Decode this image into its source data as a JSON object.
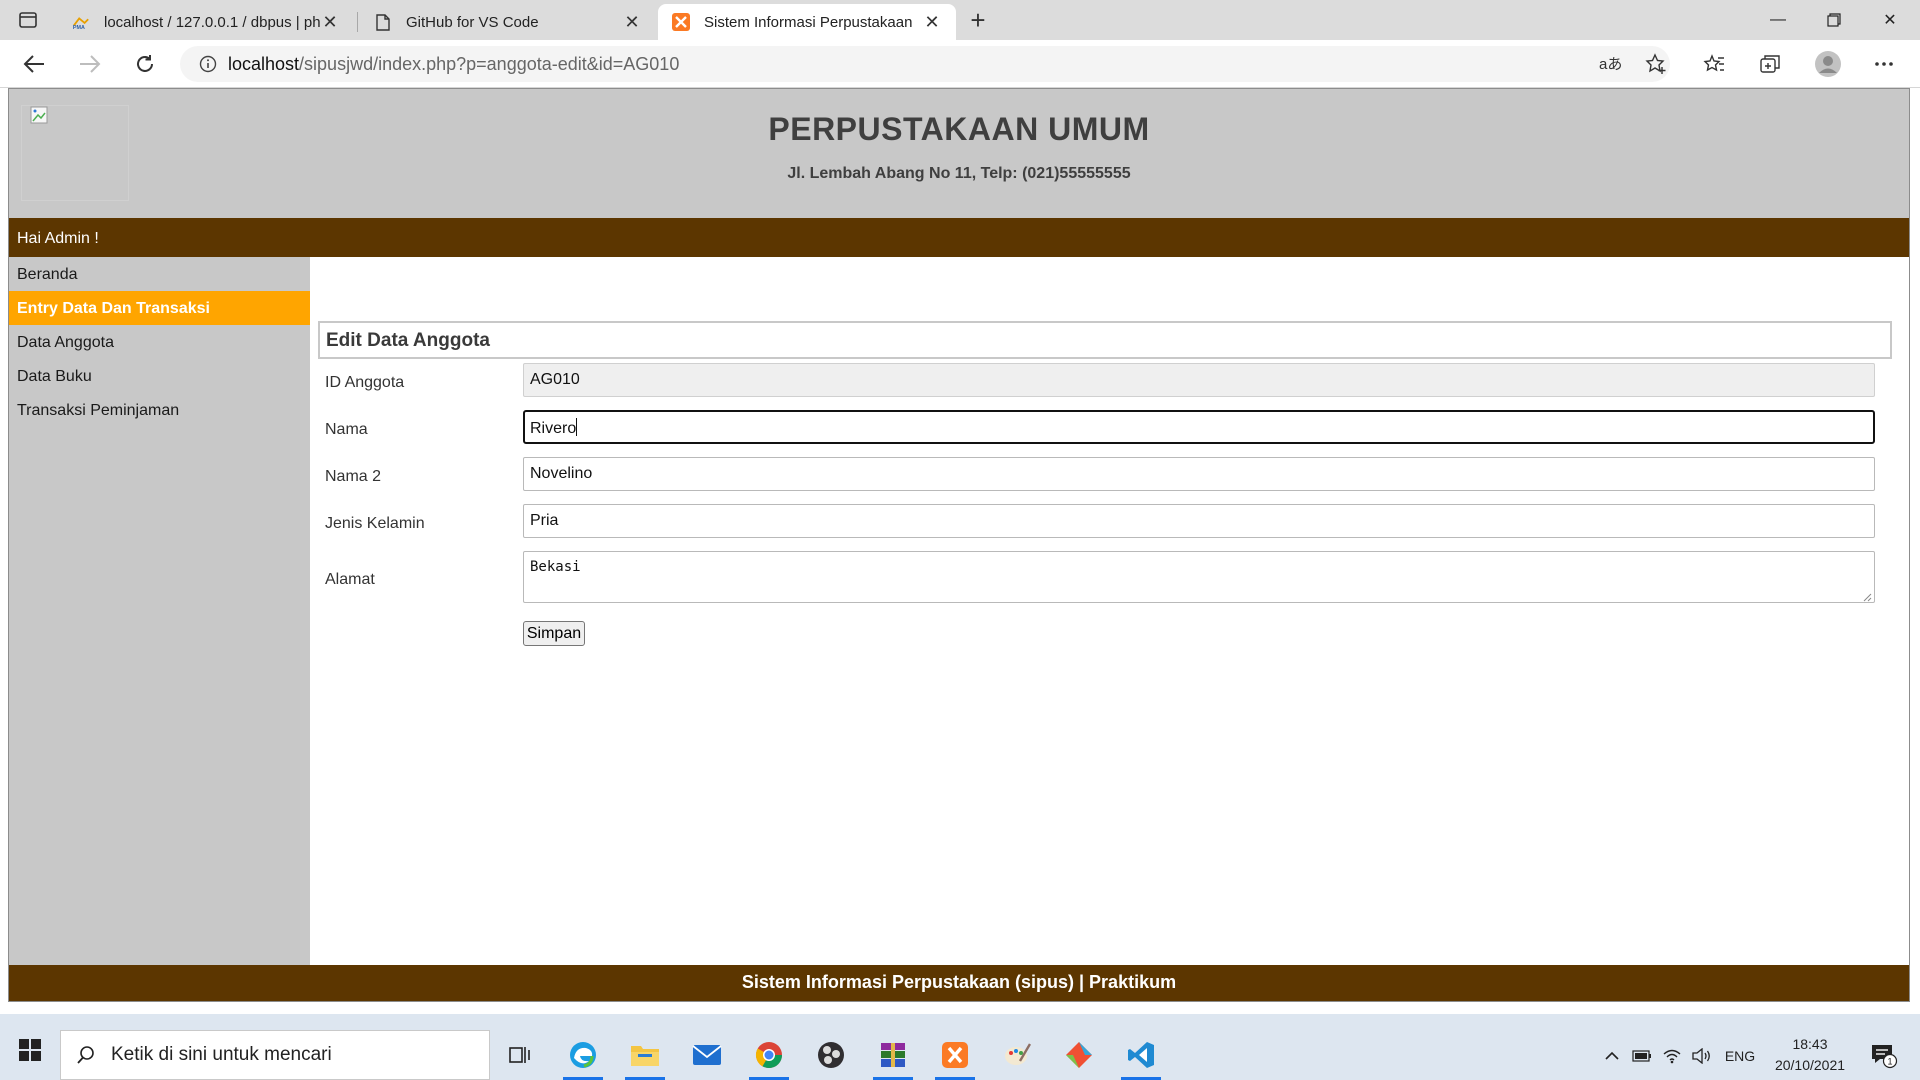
{
  "browser": {
    "tabs": [
      {
        "title": "localhost / 127.0.0.1 / dbpus | ph",
        "favicon": "phpmyadmin-icon"
      },
      {
        "title": "GitHub for VS Code",
        "favicon": "document-icon"
      },
      {
        "title": "Sistem Informasi Perpustakaan",
        "favicon": "xampp-icon",
        "active": true
      }
    ],
    "url_host": "localhost",
    "url_path": "/sipusjwd/index.php?p=anggota-edit&id=AG010"
  },
  "site": {
    "title": "PERPUSTAKAAN UMUM",
    "address": "Jl. Lembah Abang No 11, Telp: (021)55555555",
    "greeting": "Hai Admin !",
    "menu": [
      {
        "label": "Beranda",
        "active": false
      },
      {
        "label": "Entry Data Dan Transaksi",
        "active": true
      },
      {
        "label": "Data Anggota",
        "active": false
      },
      {
        "label": "Data Buku",
        "active": false
      },
      {
        "label": "Transaksi Peminjaman",
        "active": false
      }
    ],
    "footer": "Sistem Informasi Perpustakaan (sipus) | Praktikum",
    "colors": {
      "header_bg": "#c8c8c8",
      "bar_bg": "#5c3600",
      "menu_active": "#ffa500"
    }
  },
  "form": {
    "heading": "Edit Data Anggota",
    "fields": [
      {
        "label": "ID Anggota",
        "value": "AG010",
        "readonly": true
      },
      {
        "label": "Nama",
        "value": "Rivero",
        "focused": true
      },
      {
        "label": "Nama 2",
        "value": "Novelino"
      },
      {
        "label": "Jenis Kelamin",
        "value": "Pria"
      },
      {
        "label": "Alamat",
        "value": "Bekasi",
        "multiline": true
      }
    ],
    "submit_label": "Simpan"
  },
  "taskbar": {
    "search_placeholder": "Ketik di sini untuk mencari",
    "language": "ENG",
    "time": "18:43",
    "date": "20/10/2021",
    "notification_count": "1",
    "pinned_apps": [
      "task-view-icon",
      "edge-icon",
      "file-explorer-icon",
      "mail-icon",
      "chrome-icon",
      "obs-icon",
      "winrar-icon",
      "xampp-icon",
      "paint-icon",
      "git-icon",
      "vscode-icon"
    ]
  }
}
